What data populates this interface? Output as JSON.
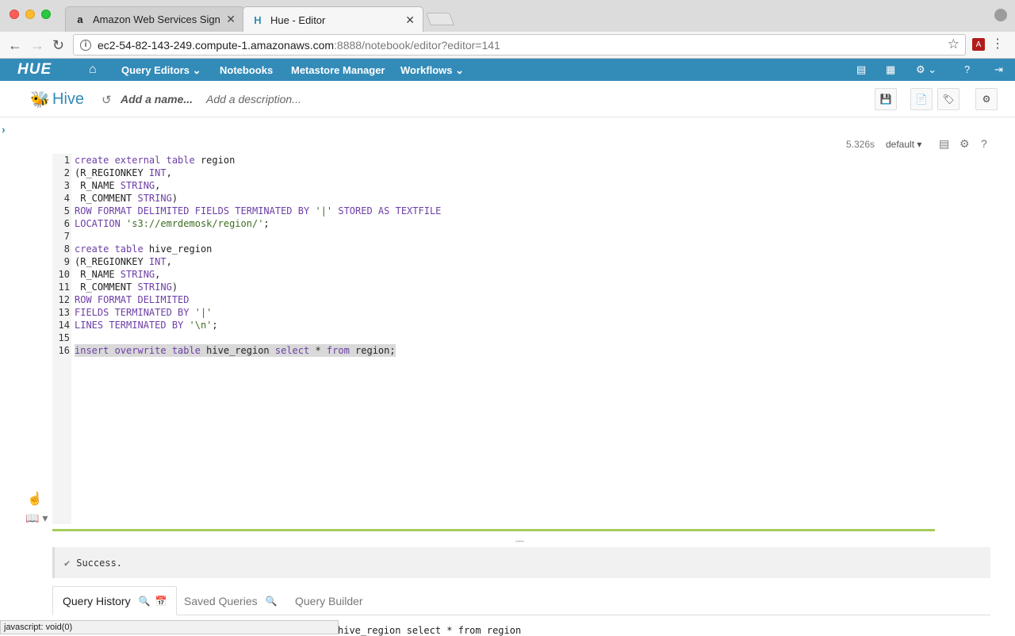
{
  "browser": {
    "tabs": [
      {
        "title": "Amazon Web Services Sign In",
        "favicon": "a"
      },
      {
        "title": "Hue - Editor",
        "favicon": "H"
      }
    ],
    "url_host": "ec2-54-82-143-249.compute-1.amazonaws.com",
    "url_path": ":8888/notebook/editor?editor=141",
    "status_text": "javascript: void(0)"
  },
  "hue_nav": {
    "logo": "HUE",
    "items": [
      "Query Editors",
      "Notebooks",
      "Metastore Manager",
      "Workflows"
    ]
  },
  "editor_header": {
    "title": "Hive",
    "name_placeholder": "Add a name...",
    "description_placeholder": "Add a description..."
  },
  "snippet": {
    "exec_time": "5.326s",
    "database": "default"
  },
  "code_lines": [
    {
      "n": "1",
      "parts": [
        [
          "kw",
          "create external table "
        ],
        [
          "plain",
          "region"
        ]
      ]
    },
    {
      "n": "2",
      "parts": [
        [
          "plain",
          "(R_REGIONKEY "
        ],
        [
          "kw",
          "INT"
        ],
        [
          "plain",
          ","
        ]
      ]
    },
    {
      "n": "3",
      "parts": [
        [
          "plain",
          " R_NAME "
        ],
        [
          "kw",
          "STRING"
        ],
        [
          "plain",
          ","
        ]
      ]
    },
    {
      "n": "4",
      "parts": [
        [
          "plain",
          " R_COMMENT "
        ],
        [
          "kw",
          "STRING"
        ],
        [
          "plain",
          ")"
        ]
      ]
    },
    {
      "n": "5",
      "parts": [
        [
          "kw",
          "ROW FORMAT DELIMITED FIELDS TERMINATED BY "
        ],
        [
          "str",
          "'|'"
        ],
        [
          "kw",
          " STORED AS TEXTFILE"
        ]
      ]
    },
    {
      "n": "6",
      "parts": [
        [
          "kw",
          "LOCATION "
        ],
        [
          "str",
          "'s3://emrdemosk/region/'"
        ],
        [
          "plain",
          ";"
        ]
      ]
    },
    {
      "n": "7",
      "parts": []
    },
    {
      "n": "8",
      "parts": [
        [
          "kw",
          "create table "
        ],
        [
          "plain",
          "hive_region"
        ]
      ]
    },
    {
      "n": "9",
      "parts": [
        [
          "plain",
          "(R_REGIONKEY "
        ],
        [
          "kw",
          "INT"
        ],
        [
          "plain",
          ","
        ]
      ]
    },
    {
      "n": "10",
      "parts": [
        [
          "plain",
          " R_NAME "
        ],
        [
          "kw",
          "STRING"
        ],
        [
          "plain",
          ","
        ]
      ]
    },
    {
      "n": "11",
      "parts": [
        [
          "plain",
          " R_COMMENT "
        ],
        [
          "kw",
          "STRING"
        ],
        [
          "plain",
          ")"
        ]
      ]
    },
    {
      "n": "12",
      "parts": [
        [
          "kw",
          "ROW FORMAT DELIMITED"
        ]
      ]
    },
    {
      "n": "13",
      "parts": [
        [
          "kw",
          "FIELDS TERMINATED BY "
        ],
        [
          "str",
          "'|'"
        ]
      ]
    },
    {
      "n": "14",
      "parts": [
        [
          "kw",
          "LINES TERMINATED BY "
        ],
        [
          "str",
          "'\\n'"
        ],
        [
          "plain",
          ";"
        ]
      ]
    },
    {
      "n": "15",
      "parts": []
    },
    {
      "n": "16",
      "selected": true,
      "parts": [
        [
          "kw",
          "insert overwrite table "
        ],
        [
          "plain",
          "hive_region "
        ],
        [
          "kw",
          "select "
        ],
        [
          "plain",
          "* "
        ],
        [
          "kw",
          "from "
        ],
        [
          "plain",
          "region;"
        ]
      ]
    }
  ],
  "result": {
    "message": "Success."
  },
  "bottom_tabs": [
    "Query History",
    "Saved Queries",
    "Query Builder"
  ],
  "peek_text": "hive_region select * from region"
}
